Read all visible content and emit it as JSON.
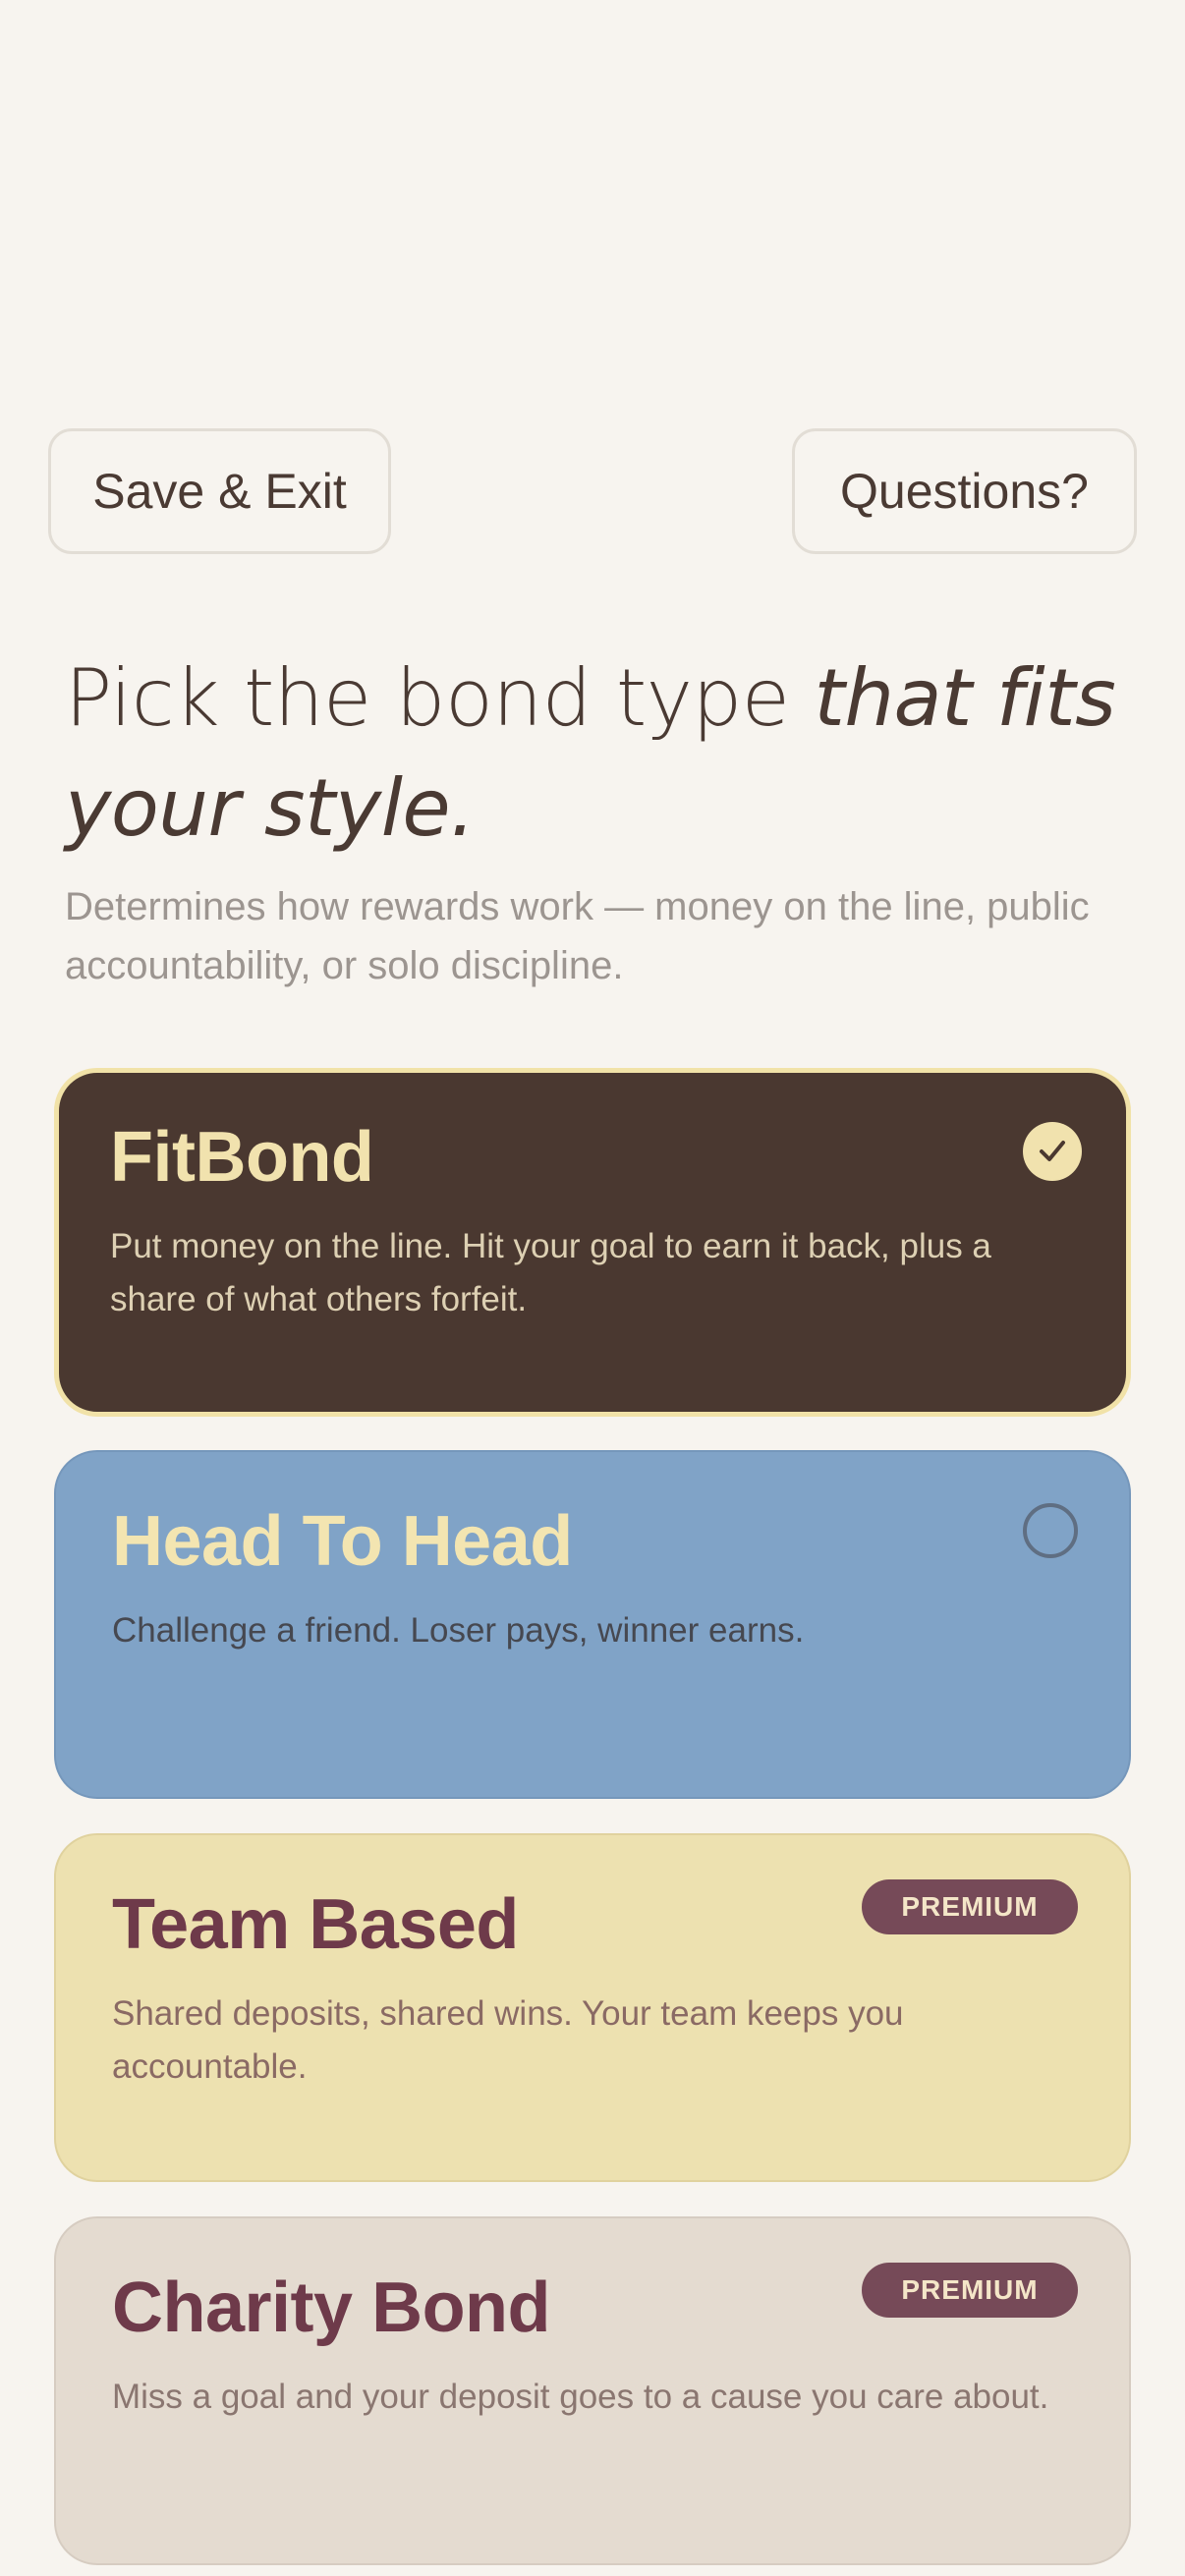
{
  "header": {
    "save_exit_label": "Save & Exit",
    "questions_label": "Questions?"
  },
  "heading": {
    "regular": "Pick the bond type ",
    "italic": "that fits your style."
  },
  "subtitle": "Determines how rewards work — money on the line, public accountability, or solo discipline.",
  "options": [
    {
      "title": "FitBond",
      "description": "Put money on the line. Hit your goal to earn it back, plus a share of what others forfeit.",
      "selected": true
    },
    {
      "title": "Head To Head",
      "description": "Challenge a friend. Loser pays, winner earns.",
      "selected": false
    },
    {
      "title": "Team Based",
      "description": "Shared deposits, shared wins. Your team keeps you accountable.",
      "badge": "PREMIUM"
    },
    {
      "title": "Charity Bond",
      "description": "Miss a goal and your deposit goes to a cause you care about.",
      "badge": "PREMIUM"
    }
  ],
  "icons": {
    "selected": "check-circle-icon",
    "unselected": "radio-empty-icon"
  },
  "colors": {
    "background": "#f7f4ef",
    "fitbond_card": "#4a3830",
    "head_to_head_card": "#80a3c7",
    "team_card": "#ede1b0",
    "charity_card": "#e4dbd0",
    "premium_badge": "#764a58",
    "accent_cream": "#f1e2ae"
  }
}
